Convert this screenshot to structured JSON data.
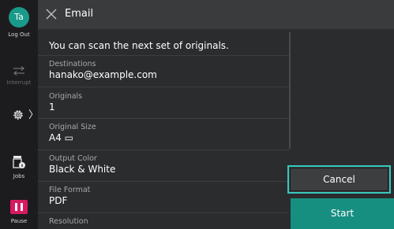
{
  "rail": {
    "avatar_initials": "Ta",
    "logout_label": "Log Out",
    "interrupt_label": "Interrupt",
    "chevron": "〉",
    "jobs_label": "Jobs",
    "pause_label": "Pause"
  },
  "header": {
    "title": "Email"
  },
  "main": {
    "message": "You can scan the next set of originals.",
    "fields": [
      {
        "label": "Destinations",
        "value": "hanako@example.com"
      },
      {
        "label": "Originals",
        "value": "1"
      },
      {
        "label": "Original Size",
        "value": "A4 ▭"
      },
      {
        "label": "Output Color",
        "value": "Black & White"
      },
      {
        "label": "File Format",
        "value": "PDF"
      },
      {
        "label": "Resolution",
        "value": ""
      }
    ]
  },
  "actions": {
    "cancel_label": "Cancel",
    "start_label": "Start"
  },
  "colors": {
    "accent": "#178f80",
    "focus": "#35c8bc",
    "pause": "#d81a63",
    "avatar": "#1a9a8a"
  }
}
